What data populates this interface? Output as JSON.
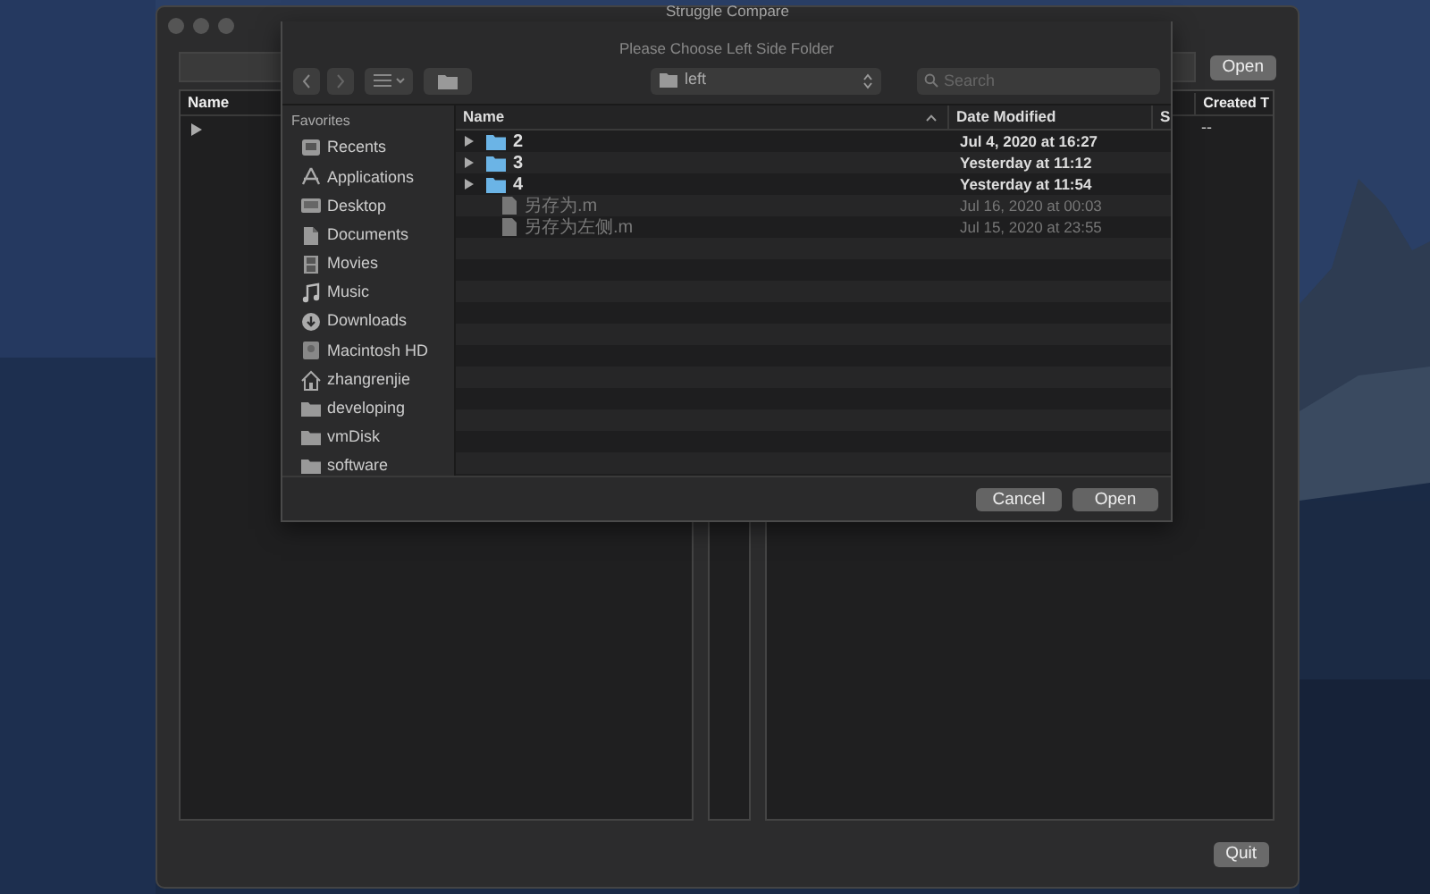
{
  "window": {
    "title": "Struggle Compare"
  },
  "open_button": "Open",
  "left_pane": {
    "columns": [
      "Name"
    ],
    "rows": [
      {
        "expanded": false
      }
    ]
  },
  "right_pane": {
    "columns": [
      "Created T"
    ],
    "rows": [
      {
        "cell": "--"
      }
    ]
  },
  "quit_button": "Quit",
  "dialog": {
    "title": "Please Choose Left Side Folder",
    "location": "left",
    "search": {
      "placeholder": "Search"
    },
    "sidebar": {
      "heading": "Favorites",
      "items": [
        {
          "label": "Recents",
          "kind": "recents"
        },
        {
          "label": "Applications",
          "kind": "apps"
        },
        {
          "label": "Desktop",
          "kind": "desktop"
        },
        {
          "label": "Documents",
          "kind": "documents"
        },
        {
          "label": "Movies",
          "kind": "movies"
        },
        {
          "label": "Music",
          "kind": "music"
        },
        {
          "label": "Downloads",
          "kind": "downloads"
        },
        {
          "label": "Macintosh HD",
          "kind": "disk"
        },
        {
          "label": "zhangrenjie",
          "kind": "home"
        },
        {
          "label": "developing",
          "kind": "folder"
        },
        {
          "label": "vmDisk",
          "kind": "folder"
        },
        {
          "label": "software",
          "kind": "folder"
        }
      ]
    },
    "columns": [
      "Name",
      "Date Modified",
      "S"
    ],
    "rows": [
      {
        "name": "2",
        "kind": "folder",
        "date": "Jul 4, 2020 at 16:27",
        "disabled": false
      },
      {
        "name": "3",
        "kind": "folder",
        "date": "Yesterday at 11:12",
        "disabled": false
      },
      {
        "name": "4",
        "kind": "folder",
        "date": "Yesterday at 11:54",
        "disabled": false
      },
      {
        "name": "另存为.m",
        "kind": "file",
        "date": "Jul 16, 2020 at 00:03",
        "disabled": true
      },
      {
        "name": "另存为左侧.m",
        "kind": "file",
        "date": "Jul 15, 2020 at 23:55",
        "disabled": true
      }
    ],
    "buttons": [
      "Cancel",
      "Open"
    ]
  }
}
